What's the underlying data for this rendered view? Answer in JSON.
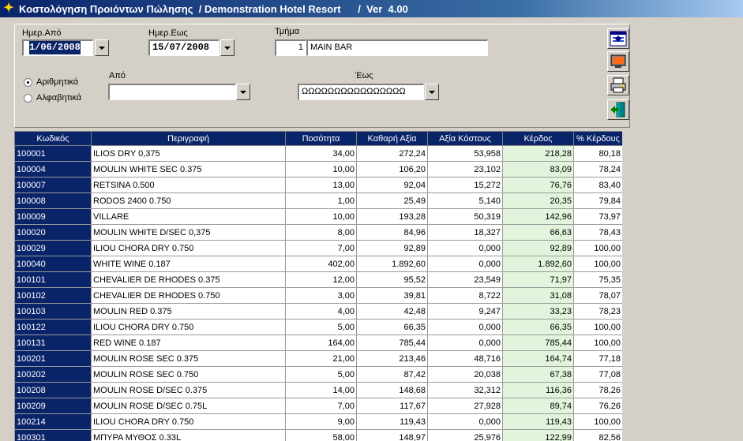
{
  "title": "Κοστολόγηση Προιόντων Πώλησης  / Demonstration Hotel Resort      /  Ver  4.00",
  "filters": {
    "date_from_label": "Ημερ.Από",
    "date_from_value": "1/06/2008",
    "date_to_label": "Ημερ.Εως",
    "date_to_value": "15/07/2008",
    "department_label": "Τμήμα",
    "department_code": "1",
    "department_name": "MAIN BAR",
    "from_label": "Από",
    "from_value": "",
    "to_label": "Έως",
    "to_value": "ΩΩΩΩΩΩΩΩΩΩΩΩΩΩΩΩ",
    "radio_numeric": "Αριθμητικά",
    "radio_alpha": "Αλφαβητικά"
  },
  "toolbar": {
    "buttons": [
      "window-icon",
      "monitor-icon",
      "printer-icon",
      "exit-door-icon"
    ]
  },
  "grid": {
    "columns": [
      "Κωδικός",
      "Περιγραφή",
      "Ποσότητα",
      "Καθαρή Αξία",
      "Αξία Κόστους",
      "Κέρδος",
      "% Κέρδους"
    ],
    "rows": [
      [
        "100001",
        "ILIOS DRY 0,375",
        "34,00",
        "272,24",
        "53,958",
        "218,28",
        "80,18"
      ],
      [
        "100004",
        "MOULIN WHITE SEC 0.375",
        "10,00",
        "106,20",
        "23,102",
        "83,09",
        "78,24"
      ],
      [
        "100007",
        "RETSINA 0.500",
        "13,00",
        "92,04",
        "15,272",
        "76,76",
        "83,40"
      ],
      [
        "100008",
        "RODOS 2400 0.750",
        "1,00",
        "25,49",
        "5,140",
        "20,35",
        "79,84"
      ],
      [
        "100009",
        "VILLARE",
        "10,00",
        "193,28",
        "50,319",
        "142,96",
        "73,97"
      ],
      [
        "100020",
        "MOULIN WHITE D/SEC 0,375",
        "8,00",
        "84,96",
        "18,327",
        "66,63",
        "78,43"
      ],
      [
        "100029",
        "ILIOU CHORA DRY 0.750",
        "7,00",
        "92,89",
        "0,000",
        "92,89",
        "100,00"
      ],
      [
        "100040",
        "WHITE WINE 0.187",
        "402,00",
        "1.892,60",
        "0,000",
        "1.892,60",
        "100,00"
      ],
      [
        "100101",
        "CHEVALIER DE RHODES 0.375",
        "12,00",
        "95,52",
        "23,549",
        "71,97",
        "75,35"
      ],
      [
        "100102",
        "CHEVALIER DE RHODES 0.750",
        "3,00",
        "39,81",
        "8,722",
        "31,08",
        "78,07"
      ],
      [
        "100103",
        "MOULIN RED  0.375",
        "4,00",
        "42,48",
        "9,247",
        "33,23",
        "78,23"
      ],
      [
        "100122",
        "ILIOU CHORA DRY 0.750",
        "5,00",
        "66,35",
        "0,000",
        "66,35",
        "100,00"
      ],
      [
        "100131",
        "RED WINE 0.187",
        "164,00",
        "785,44",
        "0,000",
        "785,44",
        "100,00"
      ],
      [
        "100201",
        "MOULIN ROSE SEC 0.375",
        "21,00",
        "213,46",
        "48,716",
        "164,74",
        "77,18"
      ],
      [
        "100202",
        "MOULIN ROSE SEC 0.750",
        "5,00",
        "87,42",
        "20,038",
        "67,38",
        "77,08"
      ],
      [
        "100208",
        "MOULIN ROSE D/SEC 0.375",
        "14,00",
        "148,68",
        "32,312",
        "116,36",
        "78,26"
      ],
      [
        "100209",
        "MOULIN ROSE D/SEC 0.75L",
        "7,00",
        "117,67",
        "27,928",
        "89,74",
        "76,26"
      ],
      [
        "100214",
        "ILIOU CHORA DRY 0.750",
        "9,00",
        "119,43",
        "0,000",
        "119,43",
        "100,00"
      ],
      [
        "100301",
        "ΜΠΥΡΑ ΜΥΘΟΣ 0.33L",
        "58,00",
        "148,97",
        "25,976",
        "122,99",
        "82,56"
      ]
    ]
  }
}
